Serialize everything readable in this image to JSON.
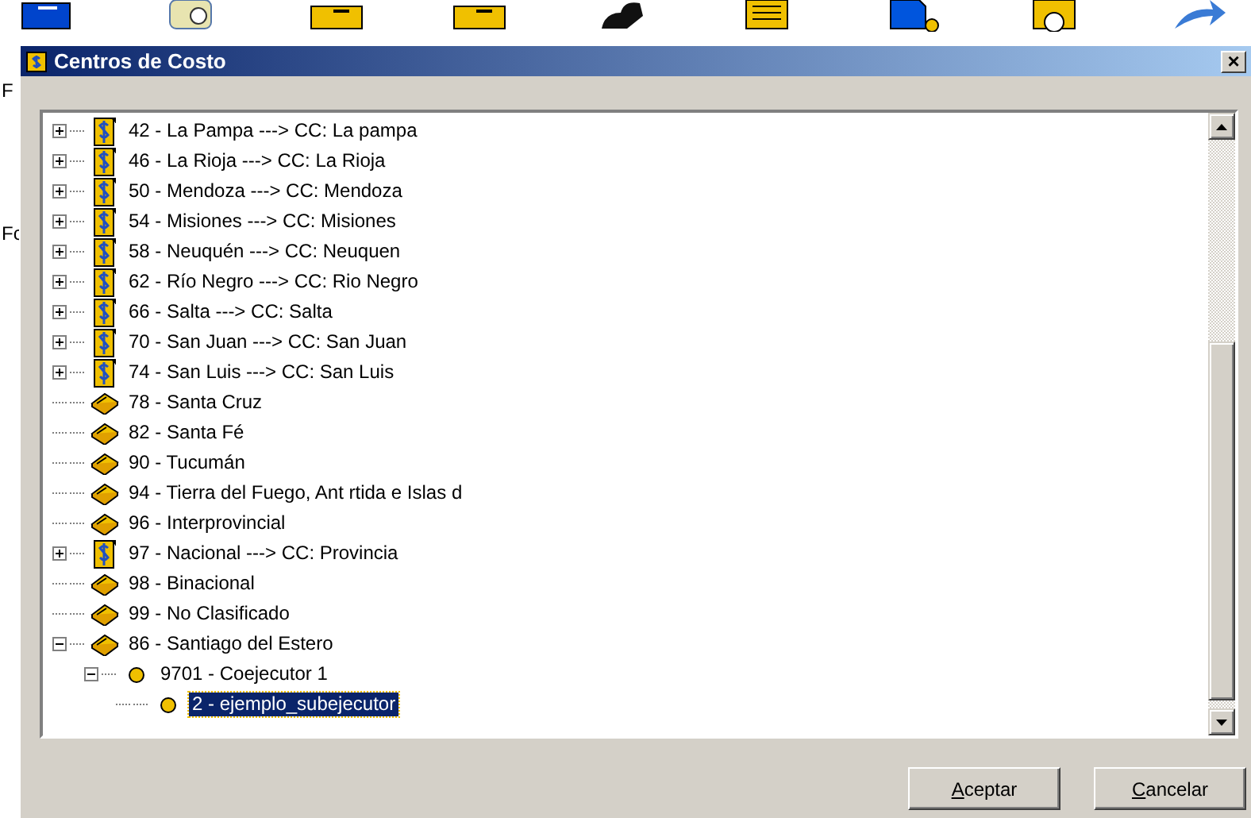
{
  "background": {
    "toolbar_icons": [
      {
        "kind": "folder-blue"
      },
      {
        "kind": "note"
      },
      {
        "kind": "folder"
      },
      {
        "kind": "folder"
      },
      {
        "kind": "figure"
      },
      {
        "kind": "document"
      },
      {
        "kind": "page"
      },
      {
        "kind": "frame"
      },
      {
        "kind": "arrow"
      }
    ],
    "labels": [
      "F",
      "Fc"
    ]
  },
  "dialog": {
    "title": "Centros de Costo",
    "close": "×",
    "tree": [
      {
        "label": "42 - La Pampa ---> CC: La pampa",
        "kind": "cost-center",
        "expandable": true,
        "expanded": false,
        "selected": false
      },
      {
        "label": "46 - La Rioja ---> CC: La Rioja",
        "kind": "cost-center",
        "expandable": true,
        "expanded": false,
        "selected": false
      },
      {
        "label": "50 - Mendoza ---> CC: Mendoza",
        "kind": "cost-center",
        "expandable": true,
        "expanded": false,
        "selected": false
      },
      {
        "label": "54 - Misiones ---> CC: Misiones",
        "kind": "cost-center",
        "expandable": true,
        "expanded": false,
        "selected": false
      },
      {
        "label": "58 - Neuquén ---> CC: Neuquen",
        "kind": "cost-center",
        "expandable": true,
        "expanded": false,
        "selected": false
      },
      {
        "label": "62 - Río Negro ---> CC: Rio Negro",
        "kind": "cost-center",
        "expandable": true,
        "expanded": false,
        "selected": false
      },
      {
        "label": "66 - Salta ---> CC: Salta",
        "kind": "cost-center",
        "expandable": true,
        "expanded": false,
        "selected": false
      },
      {
        "label": "70 - San Juan ---> CC: San Juan",
        "kind": "cost-center",
        "expandable": true,
        "expanded": false,
        "selected": false
      },
      {
        "label": "74 - San Luis ---> CC: San Luis",
        "kind": "cost-center",
        "expandable": true,
        "expanded": false,
        "selected": false
      },
      {
        "label": "78 - Santa Cruz",
        "kind": "book",
        "expandable": false,
        "selected": false
      },
      {
        "label": "82 - Santa Fé",
        "kind": "book",
        "expandable": false,
        "selected": false
      },
      {
        "label": "90 - Tucumán",
        "kind": "book",
        "expandable": false,
        "selected": false
      },
      {
        "label": "94 - Tierra del Fuego, Ant rtida e Islas d",
        "kind": "book",
        "expandable": false,
        "selected": false
      },
      {
        "label": "96 - Interprovincial",
        "kind": "book",
        "expandable": false,
        "selected": false
      },
      {
        "label": "97 - Nacional ---> CC: Provincia",
        "kind": "cost-center",
        "expandable": true,
        "expanded": false,
        "selected": false
      },
      {
        "label": "98 - Binacional",
        "kind": "book",
        "expandable": false,
        "selected": false
      },
      {
        "label": "99 - No Clasificado",
        "kind": "book",
        "expandable": false,
        "selected": false
      },
      {
        "label": "86 - Santiago del Estero",
        "kind": "book",
        "expandable": true,
        "expanded": true,
        "selected": false,
        "children": [
          {
            "label": "9701 - Coejecutor 1",
            "kind": "dot",
            "expandable": true,
            "expanded": true,
            "selected": false,
            "children": [
              {
                "label": "2 - ejemplo_subejecutor",
                "kind": "dot",
                "expandable": false,
                "selected": true
              }
            ]
          }
        ]
      }
    ],
    "buttons": [
      {
        "label": "Aceptar"
      },
      {
        "label": "Cancelar"
      }
    ]
  }
}
